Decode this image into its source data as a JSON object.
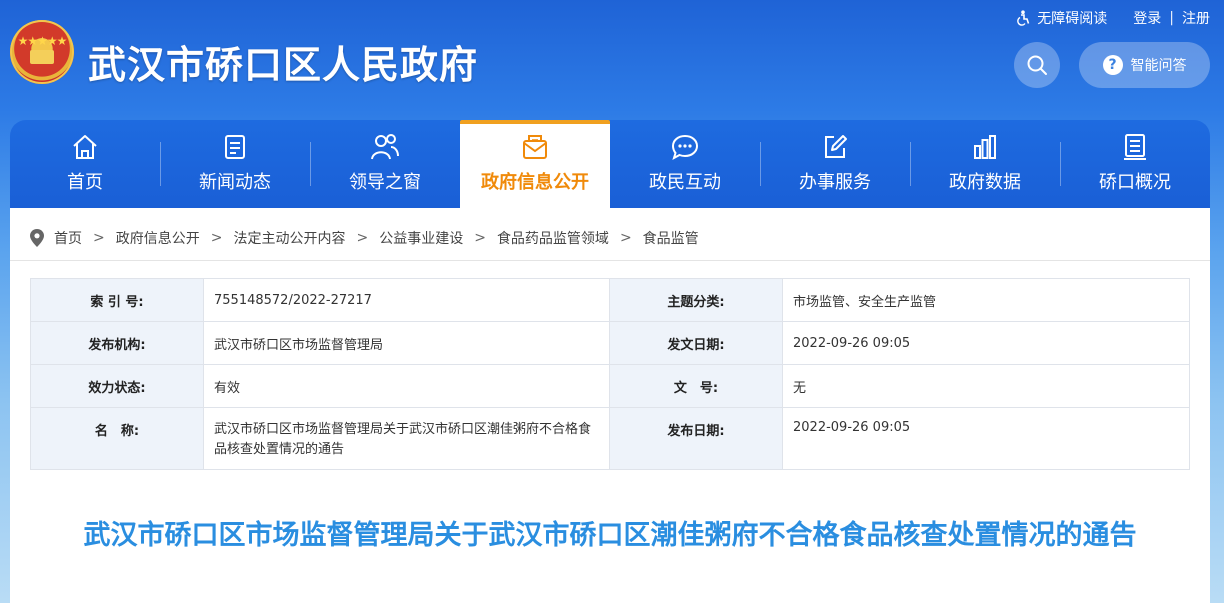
{
  "header": {
    "site_title": "武汉市硚口区人民政府",
    "accessibility": "无障碍阅读",
    "login": "登录",
    "separator": "|",
    "register": "注册",
    "qa_button": "智能问答",
    "qa_glyph": "?"
  },
  "nav": {
    "items": [
      {
        "label": "首页",
        "icon": "home-icon"
      },
      {
        "label": "新闻动态",
        "icon": "news-icon"
      },
      {
        "label": "领导之窗",
        "icon": "leaders-icon"
      },
      {
        "label": "政府信息公开",
        "icon": "mail-icon",
        "active": true
      },
      {
        "label": "政民互动",
        "icon": "chat-icon"
      },
      {
        "label": "办事服务",
        "icon": "edit-icon"
      },
      {
        "label": "政府数据",
        "icon": "bar-chart-icon"
      },
      {
        "label": "硚口概况",
        "icon": "document-icon"
      }
    ]
  },
  "breadcrumb": {
    "items": [
      "首页",
      "政府信息公开",
      "法定主动公开内容",
      "公益事业建设",
      "食品药品监管领域",
      "食品监管"
    ],
    "separator": ">"
  },
  "meta": {
    "rows": [
      {
        "k1": "索 引 号:",
        "v1": "755148572/2022-27217",
        "k2": "主题分类:",
        "v2": "市场监管、安全生产监管"
      },
      {
        "k1": "发布机构:",
        "v1": "武汉市硚口区市场监督管理局",
        "k2": "发文日期:",
        "v2": "2022-09-26 09:05"
      },
      {
        "k1": "效力状态:",
        "v1": "有效",
        "k2": "文　号:",
        "v2": "无"
      },
      {
        "k1": "名　称:",
        "v1": "武汉市硚口区市场监督管理局关于武汉市硚口区潮佳粥府不合格食品核查处置情况的通告",
        "k2": "发布日期:",
        "v2": "2022-09-26 09:05"
      }
    ]
  },
  "article": {
    "title": "武汉市硚口区市场监督管理局关于武汉市硚口区潮佳粥府不合格食品核查处置情况的通告"
  },
  "colors": {
    "header_blue": "#1f63d6",
    "active_orange": "#f08a0a",
    "title_blue": "#2a8ee0",
    "label_bg": "#eef3fa"
  }
}
